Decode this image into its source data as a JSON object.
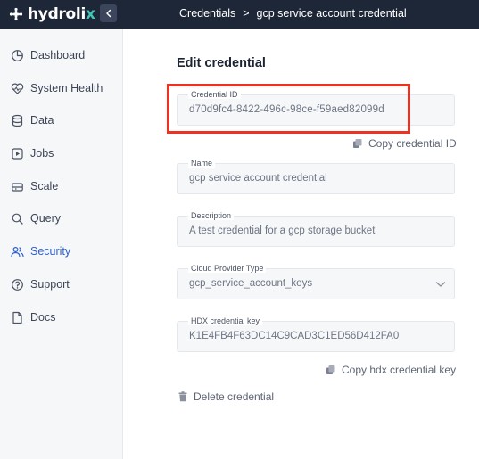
{
  "brand": {
    "name_main": "hydroli",
    "name_accent": "x"
  },
  "breadcrumb": {
    "parent": "Credentials",
    "separator": ">",
    "current": "gcp service account credential"
  },
  "sidebar": {
    "items": [
      {
        "label": "Dashboard",
        "icon": "dashboard-icon"
      },
      {
        "label": "System Health",
        "icon": "health-icon"
      },
      {
        "label": "Data",
        "icon": "database-icon"
      },
      {
        "label": "Jobs",
        "icon": "jobs-icon"
      },
      {
        "label": "Scale",
        "icon": "scale-icon"
      },
      {
        "label": "Query",
        "icon": "search-icon"
      },
      {
        "label": "Security",
        "icon": "users-icon",
        "active": true
      },
      {
        "label": "Support",
        "icon": "help-icon"
      },
      {
        "label": "Docs",
        "icon": "document-icon"
      }
    ]
  },
  "form": {
    "title": "Edit credential",
    "credential_id": {
      "label": "Credential ID",
      "value": "d70d9fc4-8422-496c-98ce-f59aed82099d"
    },
    "copy_id_label": "Copy credential ID",
    "name": {
      "label": "Name",
      "value": "gcp service account credential"
    },
    "description": {
      "label": "Description",
      "value": "A test credential for a gcp storage bucket"
    },
    "cloud_provider_type": {
      "label": "Cloud Provider Type",
      "value": "gcp_service_account_keys"
    },
    "hdx_key": {
      "label": "HDX credential key",
      "value": "K1E4FB4F63DC14C9CAD3C1ED56D412FA0"
    },
    "copy_key_label": "Copy hdx credential key",
    "delete_label": "Delete credential"
  },
  "colors": {
    "topbar": "#1e2738",
    "accent": "#43c4b7",
    "active_nav": "#2c5fd0",
    "highlight": "#ea3323"
  }
}
